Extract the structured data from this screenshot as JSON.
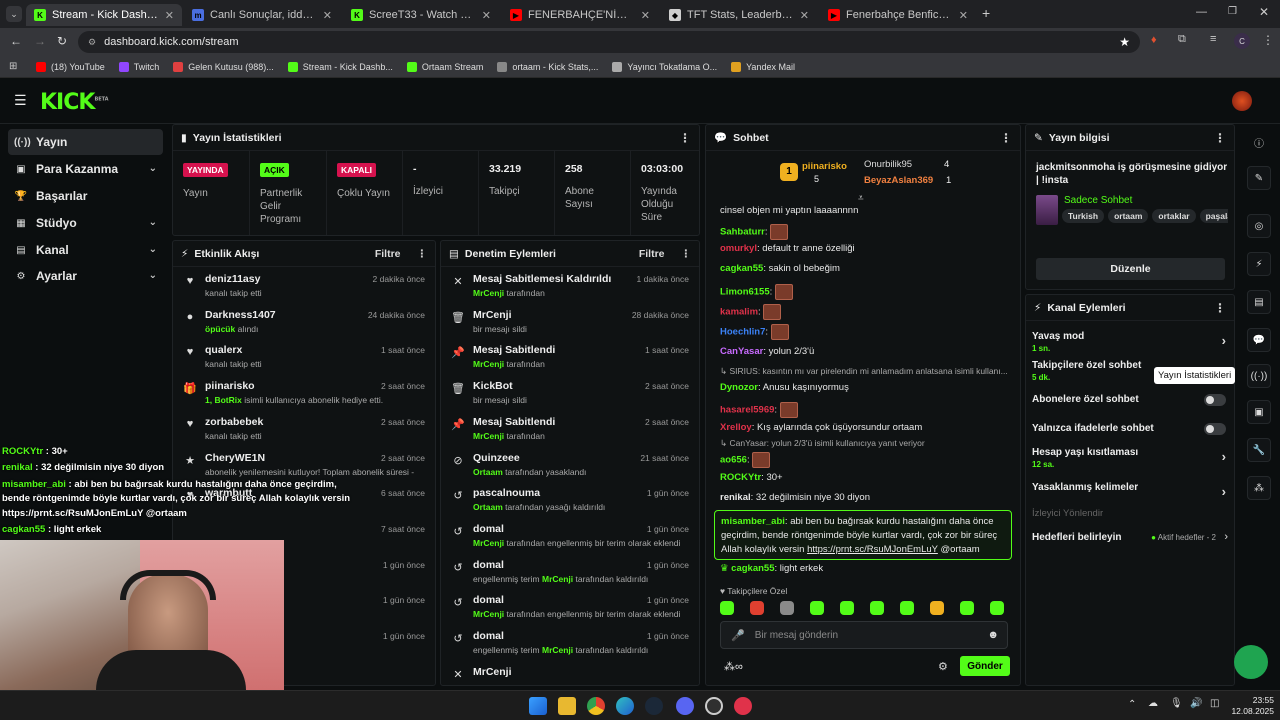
{
  "browser": {
    "tabs": [
      {
        "title": "Stream - Kick Dashboard",
        "icon_color": "#53fc18",
        "icon_letter": "K",
        "active": true
      },
      {
        "title": "Canlı Sonuçlar, iddaa sonuçları",
        "icon_color": "#4a6ee0",
        "icon_letter": "m"
      },
      {
        "title": "ScreeT33 - Watch clips on Kick",
        "icon_color": "#53fc18",
        "icon_letter": "K"
      },
      {
        "title": "FENERBAHÇE'NİN RAKİBİ | Nic",
        "icon_color": "#ff0000",
        "icon_letter": "▶"
      },
      {
        "title": "TFT Stats, Leaderboards, League",
        "icon_color": "#cfcfcf",
        "icon_letter": "◆"
      },
      {
        "title": "Fenerbahçe Benfica Maç Özeti",
        "icon_color": "#ff0000",
        "icon_letter": "▶"
      }
    ],
    "url": "dashboard.kick.com/stream",
    "profile_letter": "C",
    "bookmarks": [
      {
        "label": "(18) YouTube",
        "color": "#ff0000"
      },
      {
        "label": "Twitch",
        "color": "#9146ff"
      },
      {
        "label": "Gelen Kutusu (988)...",
        "color": "#e04040"
      },
      {
        "label": "Stream - Kick Dashb...",
        "color": "#53fc18"
      },
      {
        "label": "Ortaam Stream",
        "color": "#53fc18"
      },
      {
        "label": "ortaam - Kick Stats,...",
        "color": "#888888"
      },
      {
        "label": "Yayıncı Tokatlama O...",
        "color": "#aaaaaa"
      },
      {
        "label": "Yandex Mail",
        "color": "#e0a020"
      }
    ]
  },
  "header": {
    "logo": "KICK",
    "logo_tag": "BETA"
  },
  "sidebar": {
    "items": [
      {
        "label": "Yayın",
        "icon": "((·))",
        "expand": false,
        "selected": true
      },
      {
        "label": "Para Kazanma",
        "icon": "▣",
        "expand": true
      },
      {
        "label": "Başarılar",
        "icon": "🏆",
        "expand": false
      },
      {
        "label": "Stüdyo",
        "icon": "▦",
        "expand": true
      },
      {
        "label": "Kanal",
        "icon": "▤",
        "expand": true
      },
      {
        "label": "Ayarlar",
        "icon": "⚙",
        "expand": true
      }
    ]
  },
  "stats": {
    "title": "Yayın İstatistikleri",
    "cells": [
      {
        "value": "YAYINDA",
        "label": "Yayın",
        "badge_bg": "#d6124e",
        "badge_fg": "#ffffff"
      },
      {
        "value": "AÇIK",
        "label": "Partnerlik Gelir Programı",
        "badge_bg": "#53fc18",
        "badge_fg": "#000000"
      },
      {
        "value": "KAPALI",
        "label": "Çoklu Yayın",
        "badge_bg": "#d6124e",
        "badge_fg": "#ffffff"
      },
      {
        "value": "-",
        "label": "İzleyici"
      },
      {
        "value": "33.219",
        "label": "Takipçi"
      },
      {
        "value": "258",
        "label": "Abone Sayısı"
      },
      {
        "value": "03:03:00",
        "label": "Yayında Olduğu Süre"
      }
    ]
  },
  "activity": {
    "title": "Etkinlik Akışı",
    "filter": "Filtre",
    "items": [
      {
        "name": "deniz11asy",
        "sub": "kanalı takip etti",
        "time": "2 dakika önce",
        "icon": "♥"
      },
      {
        "name": "Darkness1407",
        "sub_hl": "öpücük",
        "sub": " alındı",
        "time": "24 dakika önce",
        "icon": "●"
      },
      {
        "name": "qualerx",
        "sub": "kanalı takip etti",
        "time": "1 saat önce",
        "icon": "♥"
      },
      {
        "name": "piinarisko",
        "sub_hl": "1, BotRix",
        "sub": " isimli kullanıcıya abonelik hediye etti.",
        "time": "2 saat önce",
        "icon": "🎁"
      },
      {
        "name": "zorbabebek",
        "sub": "kanalı takip etti",
        "time": "2 saat önce",
        "icon": "♥"
      },
      {
        "name": "CheryWE1N",
        "sub": "abonelik yenilemesini kutluyor! Toplam abonelik süresi -",
        "time": "2 saat önce",
        "icon": "★"
      },
      {
        "name": "warmbutt",
        "sub": "",
        "time": "6 saat önce",
        "icon": "♥"
      },
      {
        "name": "",
        "sub": "",
        "time": "7 saat önce",
        "icon": ""
      },
      {
        "name": "",
        "sub": "",
        "time": "1 gün önce",
        "icon": ""
      },
      {
        "name": "n abone oldu!",
        "sub": "",
        "time": "1 gün önce",
        "icon": ""
      },
      {
        "name": "len abone oldu!",
        "sub": "",
        "time": "1 gün önce",
        "icon": ""
      }
    ]
  },
  "moderation": {
    "title": "Denetim Eylemleri",
    "filter": "Filtre",
    "items": [
      {
        "name": "Mesaj Sabitlemesi Kaldırıldı",
        "hl": "MrCenji",
        "sub": " tarafından",
        "time": "1 dakika önce",
        "icon": "✕"
      },
      {
        "name": "MrCenji",
        "hl": "",
        "sub": "bir mesajı sildi",
        "time": "28 dakika önce",
        "icon": "🗑"
      },
      {
        "name": "Mesaj Sabitlendi",
        "hl": "MrCenji",
        "sub": " tarafından",
        "time": "1 saat önce",
        "icon": "📌"
      },
      {
        "name": "KickBot",
        "hl": "",
        "sub": "bir mesajı sildi",
        "time": "2 saat önce",
        "icon": "🗑"
      },
      {
        "name": "Mesaj Sabitlendi",
        "hl": "MrCenji",
        "sub": " tarafından",
        "time": "2 saat önce",
        "icon": "📌"
      },
      {
        "name": "Quinzeee",
        "hl": "Ortaam",
        "sub": " tarafından yasaklandı",
        "time": "21 saat önce",
        "icon": "⊘"
      },
      {
        "name": "pascalnouma",
        "hl": "Ortaam",
        "sub": " tarafından yasağı kaldırıldı",
        "time": "1 gün önce",
        "icon": "↺"
      },
      {
        "name": "domal",
        "hl": "MrCenji",
        "sub": " tarafından engellenmiş bir terim olarak eklendi",
        "time": "1 gün önce",
        "icon": "↺"
      },
      {
        "name": "domal",
        "pre": "engellenmiş terim ",
        "hl": "MrCenji",
        "sub": " tarafından kaldırıldı",
        "time": "1 gün önce",
        "icon": "↺"
      },
      {
        "name": "domal",
        "hl": "MrCenji",
        "sub": " tarafından engellenmiş bir terim olarak eklendi",
        "time": "1 gün önce",
        "icon": "↺"
      },
      {
        "name": "domal",
        "pre": "engellenmiş terim ",
        "hl": "MrCenji",
        "sub": " tarafından kaldırıldı",
        "time": "1 gün önce",
        "icon": "↺"
      },
      {
        "name": "MrCenji",
        "hl": "",
        "sub": "",
        "time": "",
        "icon": "✕"
      }
    ]
  },
  "chat": {
    "title": "Sohbet",
    "top_gifters": [
      {
        "rank": "1",
        "name": "piinarisko",
        "count": "5"
      },
      {
        "name": "Onurbilik95",
        "count": "4"
      },
      {
        "name": "BeyazAslan369",
        "count": "1"
      }
    ],
    "messages": [
      {
        "user": "",
        "color": "#e8e8e8",
        "text": "cinsel objen mi yaptın laaaannnn",
        "emote": false
      },
      {
        "user": "Sahbaturr",
        "color": "#53fc18",
        "text": "",
        "emote": true
      },
      {
        "user": "omurkyl",
        "color": "#e0324a",
        "text": "default tr anne özelliği",
        "emote": false
      },
      {
        "user": "cagkan55",
        "color": "#53fc18",
        "text": "sakin ol bebeğim",
        "emote": false
      },
      {
        "user": "Limon6155",
        "color": "#53fc18",
        "text": "",
        "emote": true
      },
      {
        "user": "kamalim",
        "color": "#e0324a",
        "text": "",
        "emote": true
      },
      {
        "user": "Hoechlin7",
        "color": "#3b82f6",
        "text": "",
        "emote": true
      },
      {
        "user": "CanYasar",
        "color": "#c86bff",
        "text": "yolun 2/3'ü",
        "emote": false
      },
      {
        "user": "",
        "color": "#aaaaaa",
        "text": "↳ SIRIUS: kasıntın mı var pirelendin mi anlamadım anlatsana isimli kullanı...",
        "emote": false
      },
      {
        "user": "Dynozor",
        "color": "#53fc18",
        "text": "Anusu kaşınıyormuş",
        "emote": false
      },
      {
        "user": "hasarel5969",
        "color": "#e0324a",
        "text": "",
        "emote": true
      },
      {
        "user": "Xrelloy",
        "color": "#e0324a",
        "text": "Kış aylarında çok üşüyorsundur ortaam",
        "emote": false
      },
      {
        "user": "",
        "color": "#aaaaaa",
        "text": "↳ CanYasar: yolun 2/3'ü isimli kullanıcıya yanıt veriyor",
        "emote": false
      },
      {
        "user": "ao656",
        "color": "#53fc18",
        "text": "",
        "emote": true
      },
      {
        "user": "ROCKYtr",
        "color": "#53fc18",
        "text": "30+",
        "emote": false
      },
      {
        "user": "renikal",
        "color": "#e8e8e8",
        "text": "32 değilmisin niye 30 diyon",
        "emote": false
      }
    ],
    "highlight": {
      "user": "misamber_abi",
      "text1": "abi ben bu bağırsak kurdu hastalığını daha önce",
      "text2": "geçirdim, bende röntgenimde böyle kurtlar vardı, çok zor bir süreç",
      "text3": "Allah kolaylık versin",
      "link": "https://prnt.sc/RsuMJonEmLuY",
      "tail": "@ortaam"
    },
    "last": {
      "user": "cagkan55",
      "text": "light erkek"
    },
    "followers_only": "Takipçilere Özel",
    "input_placeholder": "Bir mesaj gönderin",
    "send": "Gönder"
  },
  "info": {
    "title": "Yayın bilgisi",
    "stream_title": "jackmitsonmoha iş görüşmesine gidiyor | !insta",
    "category": "Sadece Sohbet",
    "tags": [
      "Turkish",
      "ortaam",
      "ortaklar",
      "paşala"
    ],
    "edit": "Düzenle"
  },
  "channel": {
    "title": "Kanal Eylemleri",
    "items": [
      {
        "label": "Yavaş mod",
        "sub": "1 sn.",
        "kind": "chev"
      },
      {
        "label": "Takipçilere özel sohbet",
        "sub": "5 dk.",
        "kind": "none"
      },
      {
        "label": "Abonelere özel sohbet",
        "sub": "",
        "kind": "toggle"
      },
      {
        "label": "Yalnızca ifadelerle sohbet",
        "sub": "",
        "kind": "toggle"
      },
      {
        "label": "Hesap yaşı kısıtlaması",
        "sub": "12 sa.",
        "kind": "chev"
      },
      {
        "label": "Yasaklanmış kelimeler",
        "sub": "",
        "kind": "chev"
      }
    ],
    "host_label": "İzleyici Yönlendir",
    "targets": "Hedefleri belirleyin",
    "targets_sub": "Aktif hedefler - 2",
    "tooltip": "Yayın İstatistikleri"
  },
  "overlay": {
    "lines": [
      {
        "user": "ROCKYtr",
        "text": " : 30+"
      },
      {
        "user": "renikal",
        "text": " : 32 değilmisin niye 30 diyon"
      },
      {
        "user": "misamber_abi",
        "text": " : abi ben bu bağırsak kurdu hastalığını daha önce geçirdim,"
      },
      {
        "user": "",
        "text": "bende röntgenimde böyle kurtlar vardı, çok zor bir süreç Allah kolaylık versin"
      },
      {
        "user": "",
        "text": "https://prnt.sc/RsuMJonEmLuY @ortaam"
      },
      {
        "user": "cagkan55",
        "text": " : light erkek"
      }
    ]
  },
  "taskbar": {
    "time": "23:55",
    "date": "12.08.2025"
  }
}
